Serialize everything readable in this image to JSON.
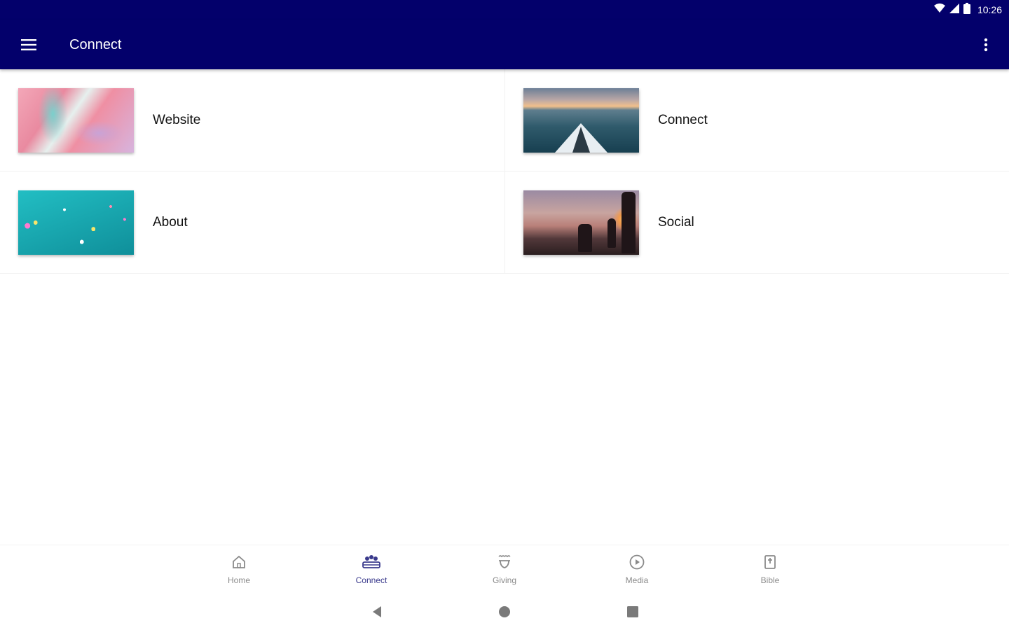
{
  "status_bar": {
    "time": "10:26",
    "icons": [
      "wifi-icon",
      "cell-signal-icon",
      "battery-icon"
    ]
  },
  "app_bar": {
    "title": "Connect",
    "menu_icon": "hamburger-menu-icon",
    "more_icon": "more-vert-icon"
  },
  "tiles": [
    {
      "label": "Website",
      "image": "pink-teal-marble-image"
    },
    {
      "label": "Connect",
      "image": "kayak-lake-sunset-image"
    },
    {
      "label": "About",
      "image": "teal-confetti-image"
    },
    {
      "label": "Social",
      "image": "people-sunset-hillside-image"
    }
  ],
  "bottom_nav": {
    "items": [
      {
        "label": "Home",
        "icon": "home-icon"
      },
      {
        "label": "Connect",
        "icon": "group-icon"
      },
      {
        "label": "Giving",
        "icon": "giving-hands-icon"
      },
      {
        "label": "Media",
        "icon": "play-circle-icon"
      },
      {
        "label": "Bible",
        "icon": "bible-icon"
      }
    ],
    "active": "Connect"
  },
  "system_nav": [
    "back-icon",
    "home-circle-icon",
    "recents-icon"
  ],
  "colors": {
    "primary": "#03006b",
    "active_nav": "#3a3a8c",
    "inactive_nav": "#8a8a8a"
  }
}
